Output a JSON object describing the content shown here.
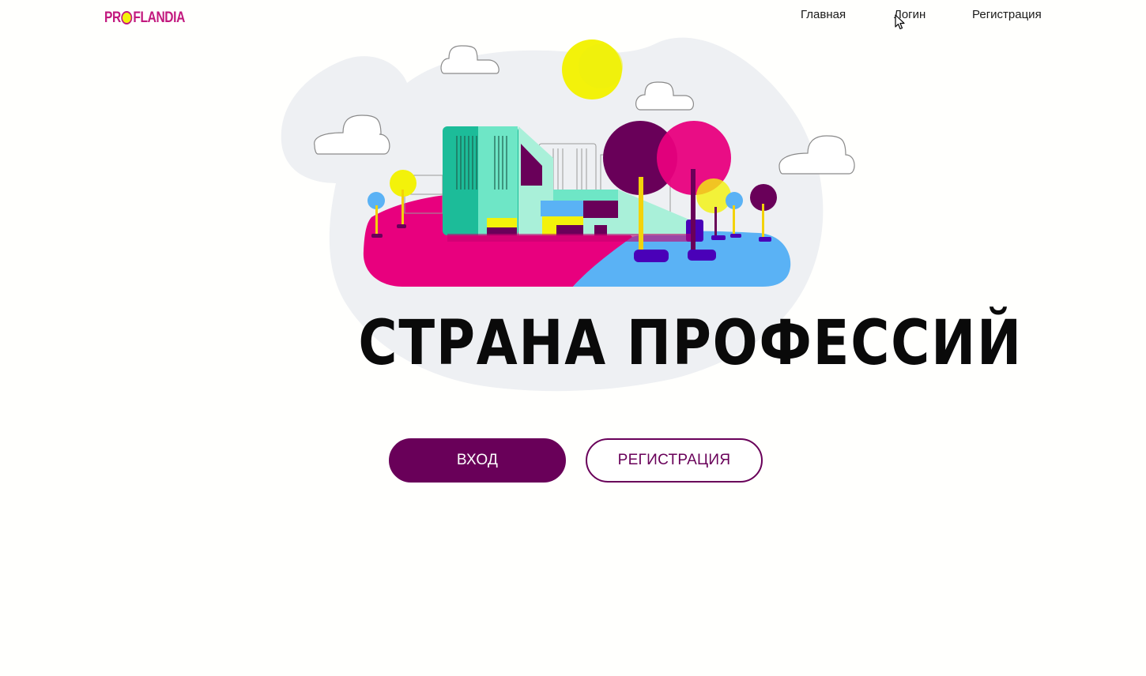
{
  "header": {
    "logo": {
      "text_before": "PR",
      "text_after": "FLANDIA"
    },
    "nav": {
      "home": "Главная",
      "login": "Логин",
      "register": "Регистрация"
    }
  },
  "hero": {
    "title": "СТРАНА ПРОФЕССИЙ"
  },
  "actions": {
    "login_label": "ВХОД",
    "register_label": "РЕГИСТРАЦИЯ"
  },
  "colors": {
    "brand": "#690059",
    "logo": "#c2187e",
    "accent_yellow": "#f3f20a",
    "pink": "#e8007e",
    "blue": "#5ab2f5",
    "teal": "#1cbc99",
    "blob": "#eef0f3"
  }
}
